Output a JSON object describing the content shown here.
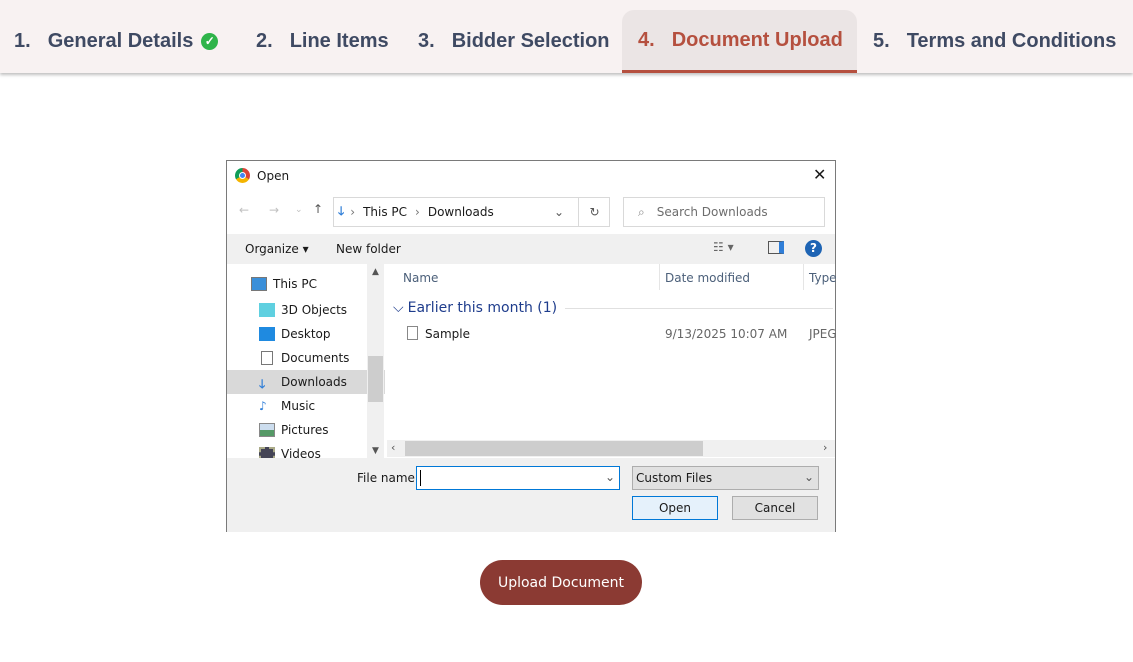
{
  "tabs": [
    {
      "num": "1.",
      "label": "General Details",
      "completed": true
    },
    {
      "num": "2.",
      "label": "Line Items"
    },
    {
      "num": "3.",
      "label": "Bidder Selection"
    },
    {
      "num": "4.",
      "label": "Document Upload",
      "active": true
    },
    {
      "num": "5.",
      "label": "Terms and Conditions"
    }
  ],
  "dialog": {
    "title": "Open",
    "path": [
      "This PC",
      "Downloads"
    ],
    "search_placeholder": "Search Downloads",
    "organize": "Organize",
    "new_folder": "New folder",
    "nav": [
      "This PC",
      "3D Objects",
      "Desktop",
      "Documents",
      "Downloads",
      "Music",
      "Pictures",
      "Videos"
    ],
    "columns": {
      "name": "Name",
      "date": "Date modified",
      "type": "Type"
    },
    "group": "Earlier this month (1)",
    "files": [
      {
        "name": "Sample",
        "date": "9/13/2025 10:07 AM",
        "type": "JPEG"
      }
    ],
    "file_name_label": "File name:",
    "file_name_value": "",
    "filter": "Custom Files",
    "open": "Open",
    "cancel": "Cancel"
  },
  "upload_button": "Upload Document",
  "colors": {
    "accent": "#b5503f",
    "button": "#8b3a33",
    "check": "#2fb44a"
  }
}
